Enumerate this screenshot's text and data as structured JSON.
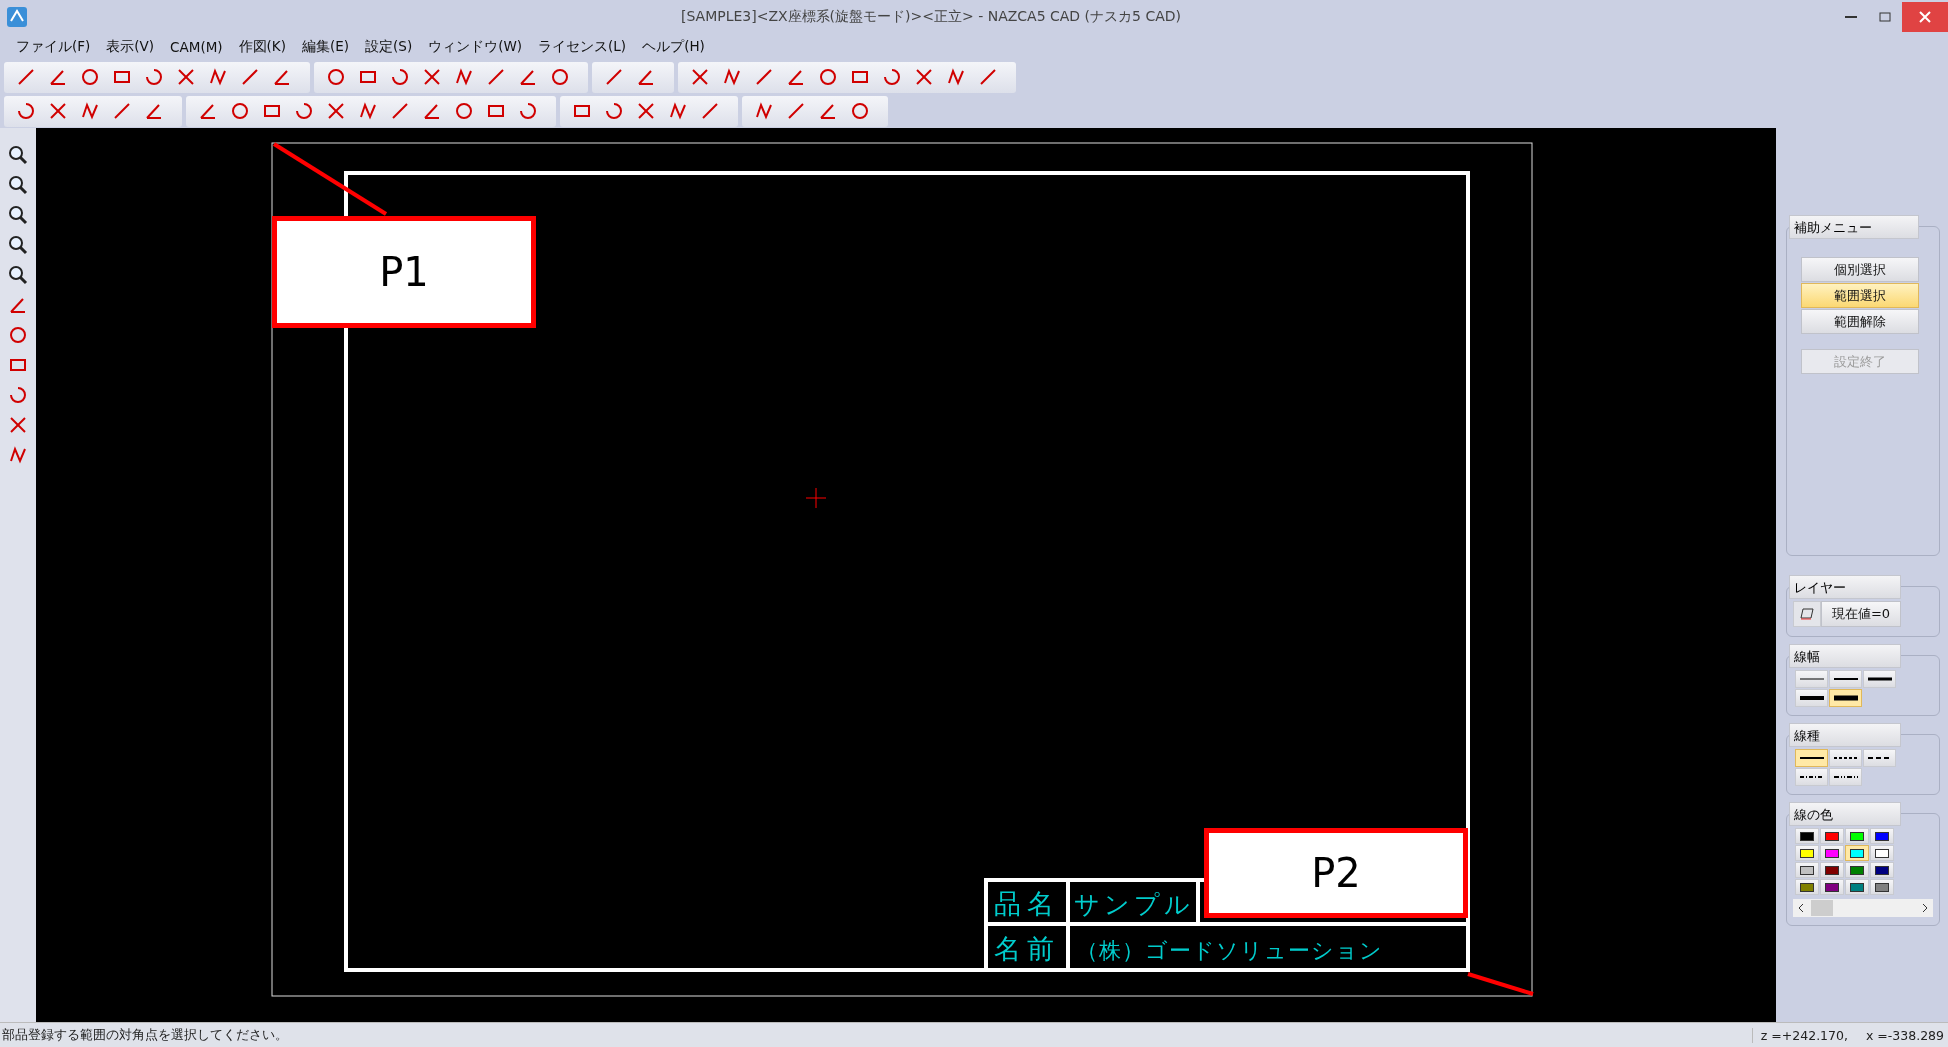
{
  "window": {
    "title": "[SAMPLE3]<ZX座標系(旋盤モード)><正立> - NAZCA5 CAD (ナスカ5 CAD)"
  },
  "menu": [
    "ファイル(F)",
    "表示(V)",
    "CAM(M)",
    "作図(K)",
    "編集(E)",
    "設定(S)",
    "ウィンドウ(W)",
    "ライセンス(L)",
    "ヘルプ(H)"
  ],
  "drawing": {
    "title_block": {
      "row_1": {
        "label": "品名",
        "value": "サンプル"
      },
      "row_2": {
        "label": "名前",
        "value": "（株）ゴードソリューション"
      }
    },
    "callouts": [
      "P1",
      "P2"
    ]
  },
  "aux_menu": {
    "title": "補助メニュー",
    "buttons": [
      {
        "label": "個別選択",
        "selected": false,
        "disabled": false
      },
      {
        "label": "範囲選択",
        "selected": true,
        "disabled": false
      },
      {
        "label": "範囲解除",
        "selected": false,
        "disabled": false
      },
      {
        "label": "設定終了",
        "selected": false,
        "disabled": true
      }
    ]
  },
  "layer": {
    "title": "レイヤー",
    "value": "現在値=0"
  },
  "line_width": {
    "title": "線幅",
    "options": [
      {
        "selected": false
      },
      {
        "selected": false
      },
      {
        "selected": false
      },
      {
        "selected": false
      },
      {
        "selected": true
      }
    ]
  },
  "line_type": {
    "title": "線種",
    "options": [
      {
        "selected": true
      },
      {
        "selected": false
      },
      {
        "selected": false
      },
      {
        "selected": false
      },
      {
        "selected": false
      }
    ]
  },
  "line_color": {
    "title": "線の色",
    "options": [
      {
        "color": "#000000",
        "selected": false
      },
      {
        "color": "#ff0000",
        "selected": false
      },
      {
        "color": "#00ff00",
        "selected": false
      },
      {
        "color": "#0000ff",
        "selected": false
      },
      {
        "color": "#ffff00",
        "selected": false
      },
      {
        "color": "#ff00ff",
        "selected": false
      },
      {
        "color": "#00ffff",
        "selected": true
      },
      {
        "color": "#ffffff",
        "selected": false
      },
      {
        "color": "#c0c0c0",
        "selected": false
      },
      {
        "color": "#800000",
        "selected": false
      },
      {
        "color": "#008000",
        "selected": false
      },
      {
        "color": "#000080",
        "selected": false
      },
      {
        "color": "#808000",
        "selected": false
      },
      {
        "color": "#800080",
        "selected": false
      },
      {
        "color": "#008080",
        "selected": false
      },
      {
        "color": "#808080",
        "selected": false
      }
    ]
  },
  "status_bar": {
    "message": "部品登録する範囲の対角点を選択してください。",
    "z": "z =+242.170,",
    "x": "x =-338.289"
  }
}
